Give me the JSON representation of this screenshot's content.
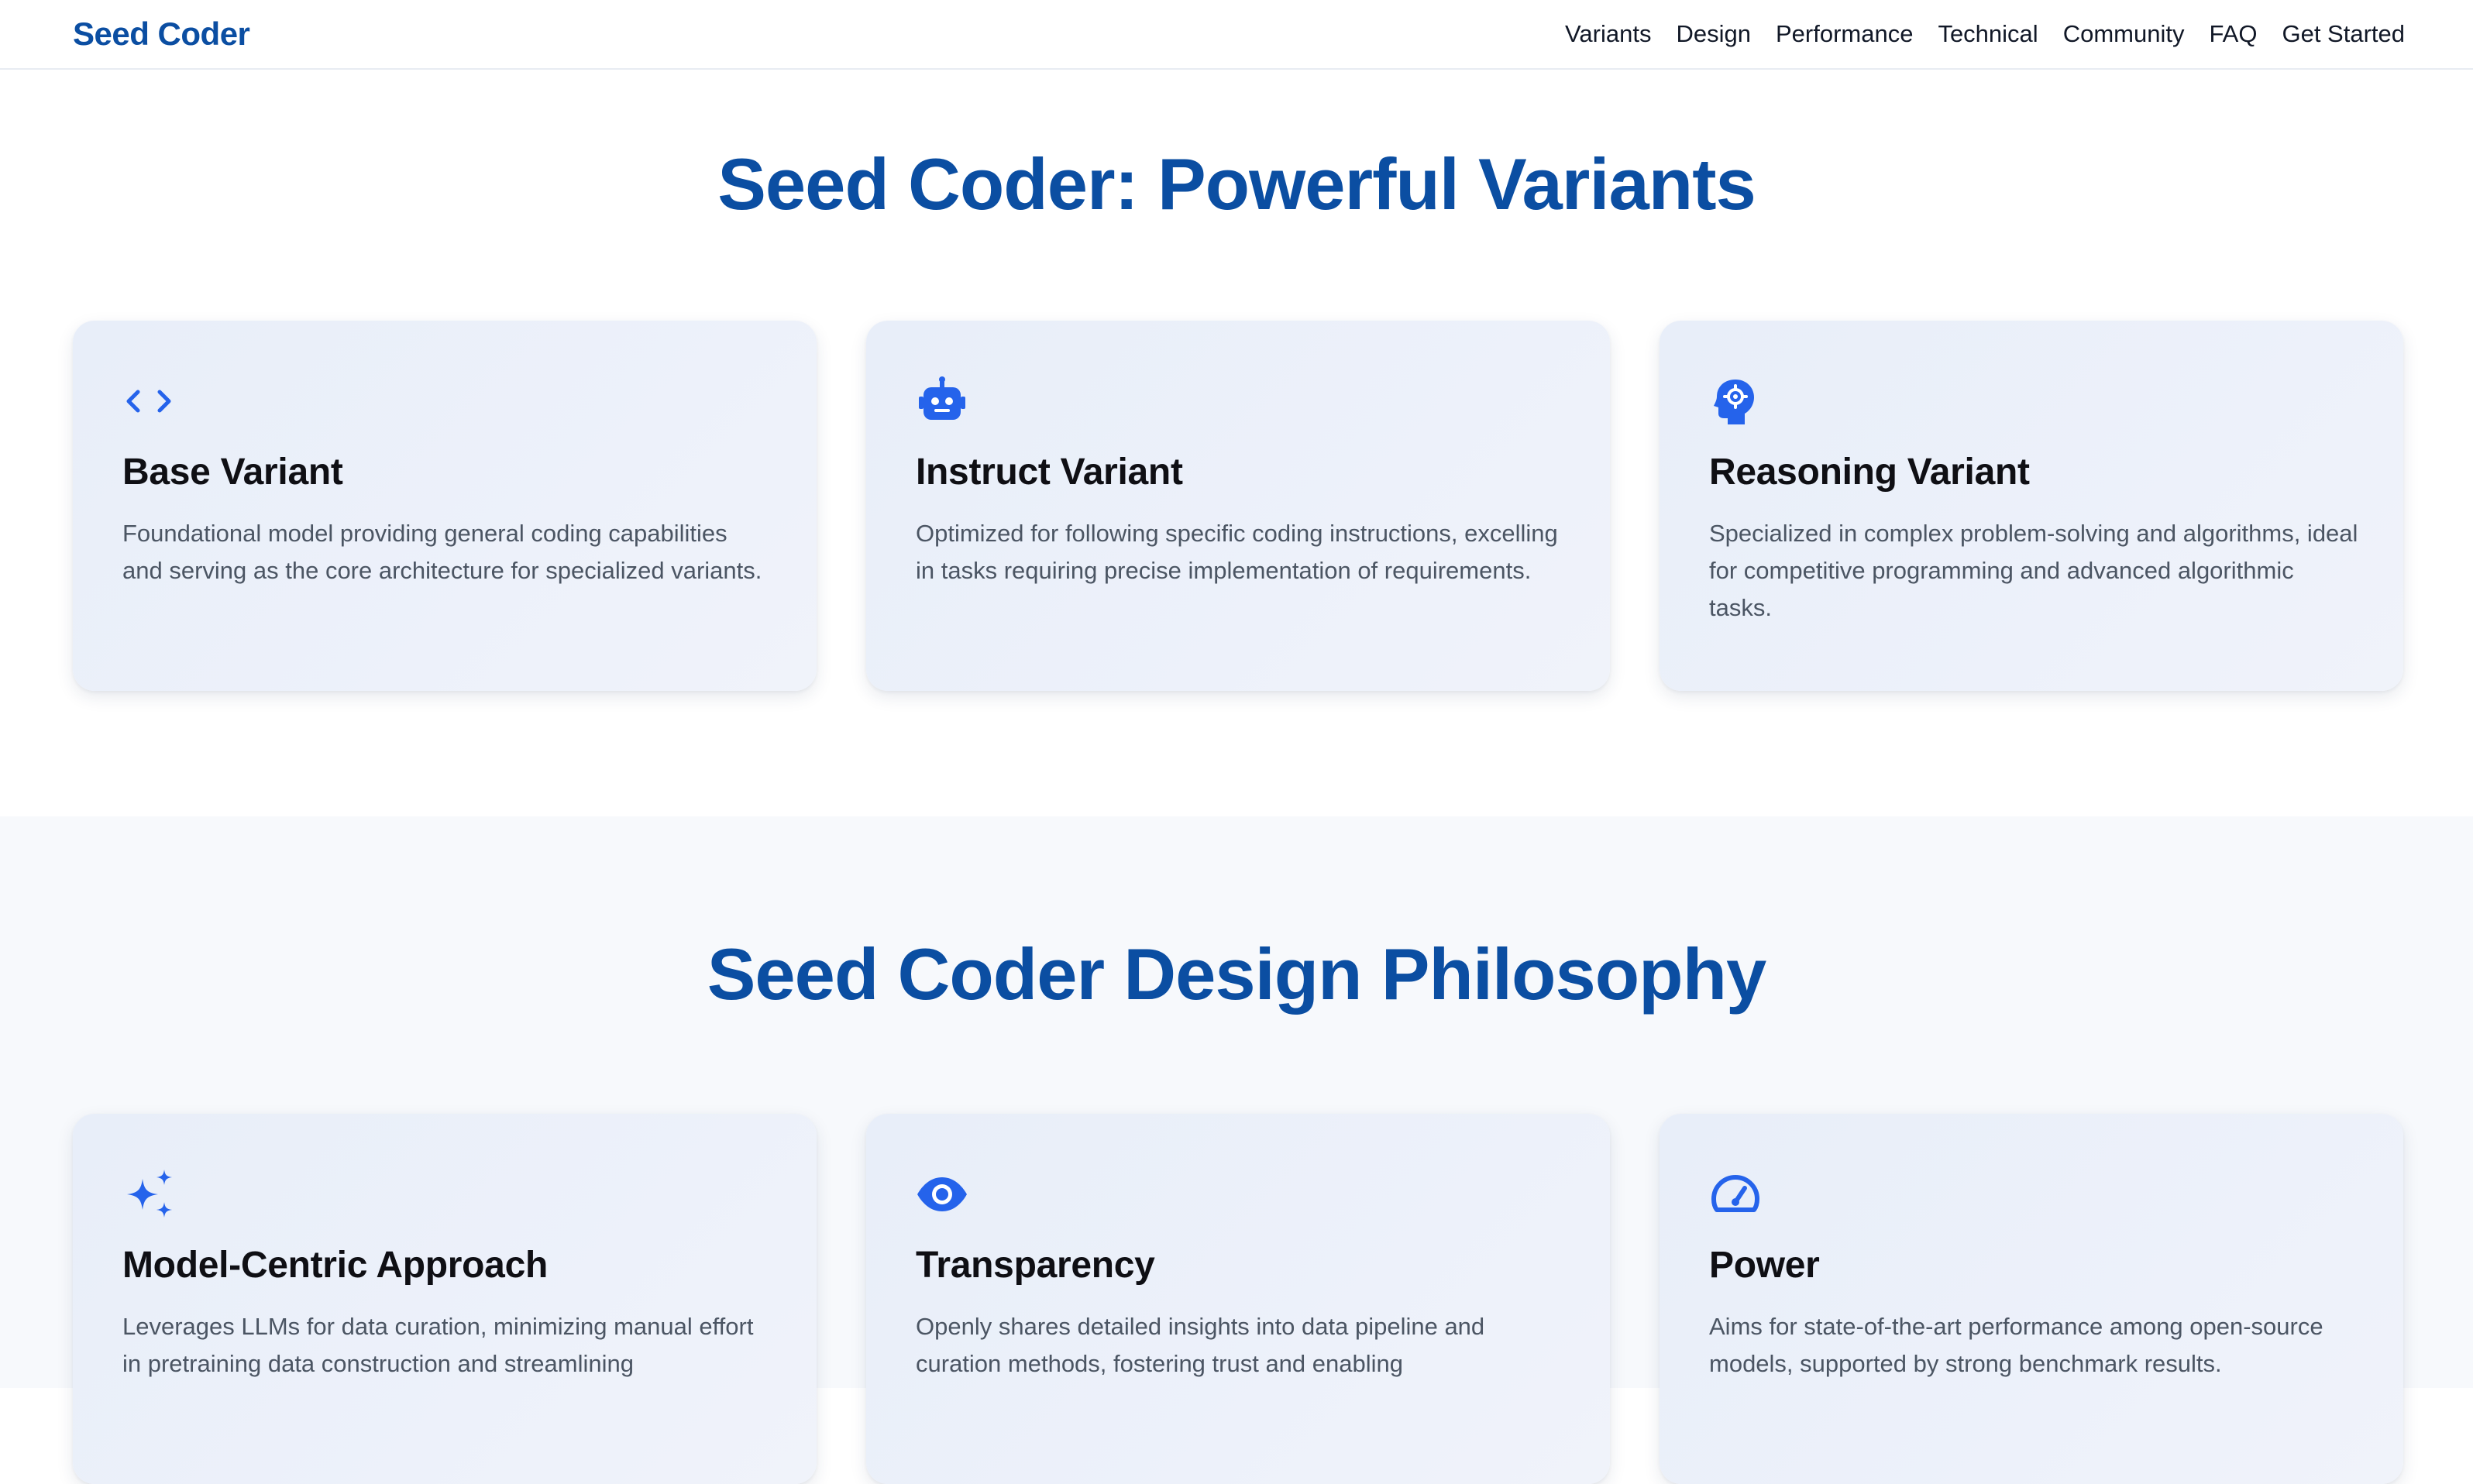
{
  "nav": {
    "logo": "Seed Coder",
    "links": [
      "Variants",
      "Design",
      "Performance",
      "Technical",
      "Community",
      "FAQ",
      "Get Started"
    ]
  },
  "variants": {
    "title": "Seed Coder: Powerful Variants",
    "cards": [
      {
        "icon": "code-icon",
        "title": "Base Variant",
        "desc": "Foundational model providing general coding capabilities and serving as the core architecture for specialized variants."
      },
      {
        "icon": "robot-icon",
        "title": "Instruct Variant",
        "desc": "Optimized for following specific coding instructions, excelling in tasks requiring precise implementation of requirements."
      },
      {
        "icon": "brain-gear-icon",
        "title": "Reasoning Variant",
        "desc": "Specialized in complex problem-solving and algorithms, ideal for competitive programming and advanced algorithmic tasks."
      }
    ]
  },
  "design": {
    "title": "Seed Coder Design Philosophy",
    "cards": [
      {
        "icon": "sparkles-icon",
        "title": "Model-Centric Approach",
        "desc": "Leverages LLMs for data curation, minimizing manual effort in pretraining data construction and streamlining"
      },
      {
        "icon": "eye-icon",
        "title": "Transparency",
        "desc": "Openly shares detailed insights into data pipeline and curation methods, fostering trust and enabling"
      },
      {
        "icon": "gauge-icon",
        "title": "Power",
        "desc": "Aims for state-of-the-art performance among open-source models, supported by strong benchmark results."
      }
    ]
  },
  "colors": {
    "accent": "#0b4ea2",
    "icon": "#2563eb",
    "card_bg": "#eaf0f9",
    "section_alt_bg": "#f7f9fc"
  }
}
